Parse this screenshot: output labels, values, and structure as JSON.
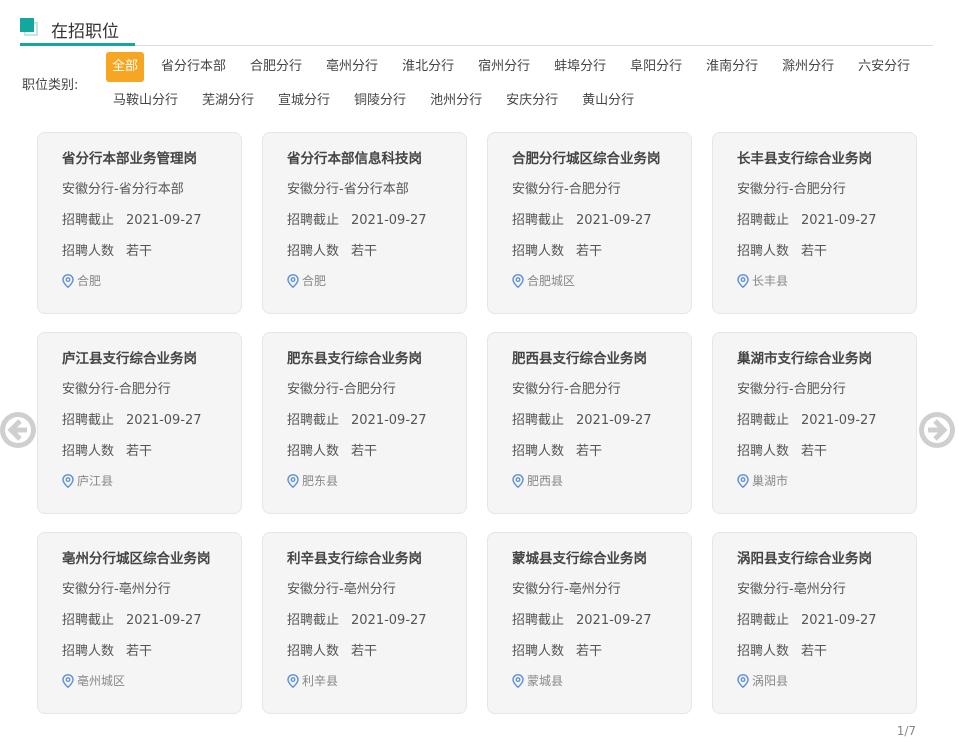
{
  "header": {
    "title": "在招职位"
  },
  "filter": {
    "label": "职位类别:",
    "row1": [
      "全部",
      "省分行本部",
      "合肥分行",
      "亳州分行",
      "淮北分行",
      "宿州分行",
      "蚌埠分行",
      "阜阳分行",
      "淮南分行",
      "滁州分行",
      "六安分行"
    ],
    "row2": [
      "马鞍山分行",
      "芜湖分行",
      "宣城分行",
      "铜陵分行",
      "池州分行",
      "安庆分行",
      "黄山分行"
    ],
    "active": "全部"
  },
  "card_labels": {
    "deadline": "招聘截止",
    "count": "招聘人数"
  },
  "jobs": [
    {
      "title": "省分行本部业务管理岗",
      "org": "安徽分行-省分行本部",
      "deadline": "2021-09-27",
      "count": "若干",
      "location": "合肥"
    },
    {
      "title": "省分行本部信息科技岗",
      "org": "安徽分行-省分行本部",
      "deadline": "2021-09-27",
      "count": "若干",
      "location": "合肥"
    },
    {
      "title": "合肥分行城区综合业务岗",
      "org": "安徽分行-合肥分行",
      "deadline": "2021-09-27",
      "count": "若干",
      "location": "合肥城区"
    },
    {
      "title": "长丰县支行综合业务岗",
      "org": "安徽分行-合肥分行",
      "deadline": "2021-09-27",
      "count": "若干",
      "location": "长丰县"
    },
    {
      "title": "庐江县支行综合业务岗",
      "org": "安徽分行-合肥分行",
      "deadline": "2021-09-27",
      "count": "若干",
      "location": "庐江县"
    },
    {
      "title": "肥东县支行综合业务岗",
      "org": "安徽分行-合肥分行",
      "deadline": "2021-09-27",
      "count": "若干",
      "location": "肥东县"
    },
    {
      "title": "肥西县支行综合业务岗",
      "org": "安徽分行-合肥分行",
      "deadline": "2021-09-27",
      "count": "若干",
      "location": "肥西县"
    },
    {
      "title": "巢湖市支行综合业务岗",
      "org": "安徽分行-合肥分行",
      "deadline": "2021-09-27",
      "count": "若干",
      "location": "巢湖市"
    },
    {
      "title": "亳州分行城区综合业务岗",
      "org": "安徽分行-亳州分行",
      "deadline": "2021-09-27",
      "count": "若干",
      "location": "亳州城区"
    },
    {
      "title": "利辛县支行综合业务岗",
      "org": "安徽分行-亳州分行",
      "deadline": "2021-09-27",
      "count": "若干",
      "location": "利辛县"
    },
    {
      "title": "蒙城县支行综合业务岗",
      "org": "安徽分行-亳州分行",
      "deadline": "2021-09-27",
      "count": "若干",
      "location": "蒙城县"
    },
    {
      "title": "涡阳县支行综合业务岗",
      "org": "安徽分行-亳州分行",
      "deadline": "2021-09-27",
      "count": "若干",
      "location": "涡阳县"
    }
  ],
  "pager": {
    "text": "1/7"
  },
  "colors": {
    "accent": "#13a89e",
    "active_chip": "#f6a623",
    "card_bg": "#f5f5f5",
    "pin": "#5b8fd6"
  },
  "icons": {
    "prev": "arrow-left-circle-icon",
    "next": "arrow-right-circle-icon",
    "location": "location-pin-icon"
  }
}
